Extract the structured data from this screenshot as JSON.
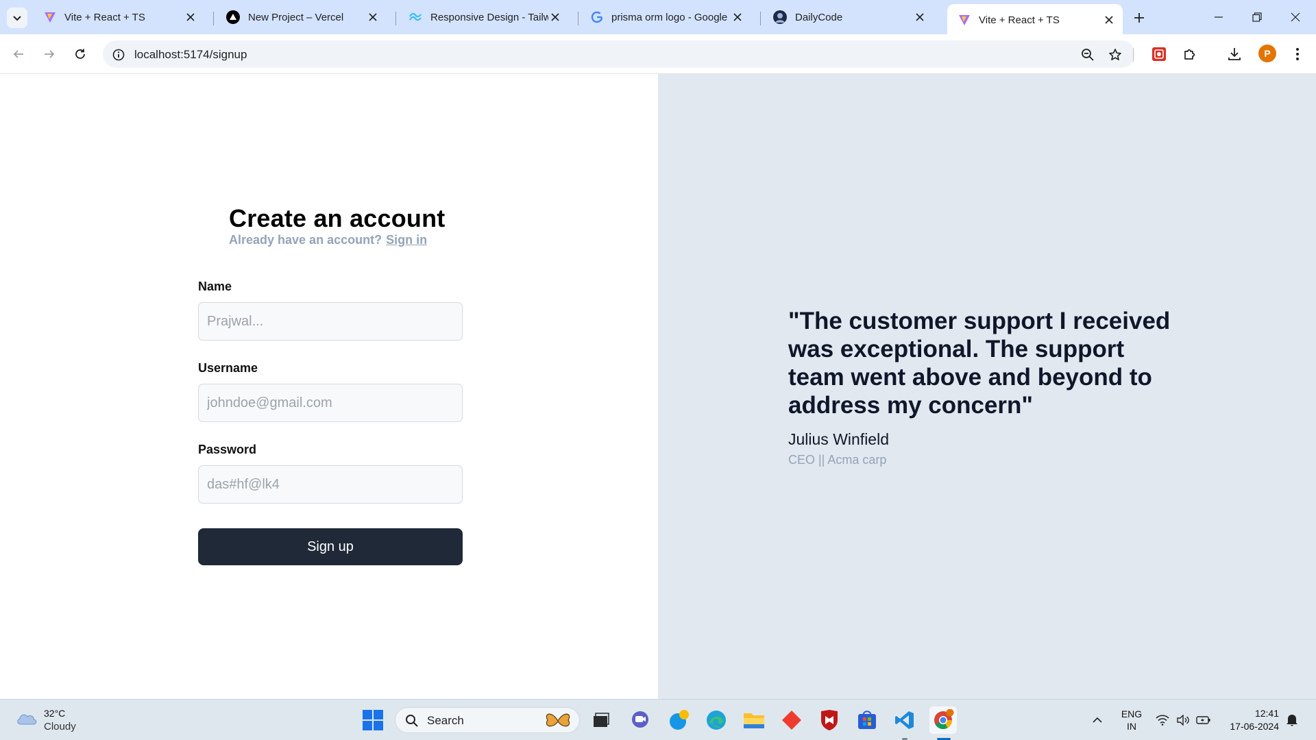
{
  "browser": {
    "tabs": [
      {
        "title": "Vite + React + TS",
        "icon": "vite-icon"
      },
      {
        "title": "New Project – Vercel",
        "icon": "vercel-icon"
      },
      {
        "title": "Responsive Design - Tailwi",
        "icon": "tailwind-icon"
      },
      {
        "title": "prisma orm logo - Google",
        "icon": "google-icon"
      },
      {
        "title": "DailyCode",
        "icon": "dailycode-icon"
      },
      {
        "title": "Vite + React + TS",
        "icon": "vite-icon",
        "active": true
      }
    ],
    "url": "localhost:5174/signup"
  },
  "signup": {
    "heading": "Create an account",
    "subtext": "Already have an account?",
    "signin_link": "Sign in",
    "fields": [
      {
        "label": "Name",
        "placeholder": "Prajwal...",
        "value": ""
      },
      {
        "label": "Username",
        "placeholder": "johndoe@gmail.com",
        "value": ""
      },
      {
        "label": "Password",
        "placeholder": "das#hf@lk4",
        "value": ""
      }
    ],
    "submit_label": "Sign up"
  },
  "testimonial": {
    "quote": "\"The customer support I received was exceptional. The support team went above and beyond to address my concern\"",
    "author": "Julius Winfield",
    "role": "CEO || Acma carp"
  },
  "taskbar": {
    "weather_temp": "32°C",
    "weather_desc": "Cloudy",
    "search_label": "Search",
    "lang_top": "ENG",
    "lang_bottom": "IN",
    "time": "12:41",
    "date": "17-06-2024"
  },
  "colors": {
    "accent_dark": "#1f2937",
    "muted": "#94a3b8",
    "panel_bg": "#e2e8f0",
    "tabstrip_bg": "#d3e3fd"
  }
}
